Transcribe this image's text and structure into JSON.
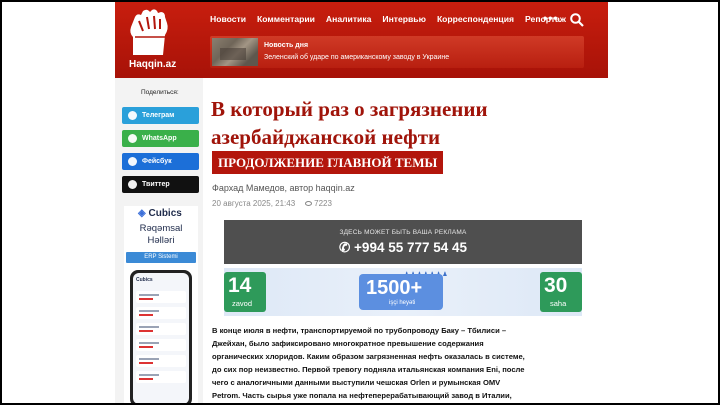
{
  "header": {
    "logo_text": "Haqqin.az",
    "nav": [
      "Новости",
      "Комментарии",
      "Аналитика",
      "Интервью",
      "Корреспонденция",
      "Репортаж"
    ],
    "more": "•••",
    "news_day": {
      "title": "Новость дня",
      "text": "Зеленский об ударе по американскому заводу в Украине"
    }
  },
  "sidebar": {
    "share_label": "Поделиться:",
    "share_buttons": [
      "Телеграм",
      "WhatsApp",
      "Фейсбук",
      "Твиттер"
    ],
    "ad": {
      "brand": "Cubics",
      "line1": "Rəqəmsal",
      "line2": "Həlləri",
      "button": "ERP Sistemi"
    }
  },
  "article": {
    "title": "В который раз о загрязнении азербайджанской нефти",
    "tag": "ПРОДОЛЖЕНИЕ ГЛАВНОЙ ТЕМЫ",
    "author": "Фархад Мамедов, автор haqqin.az",
    "date": "20 августа 2025, 21:43",
    "views": "7223",
    "body": "В конце июля в нефти, транспортируемой по трубопроводу Баку – Тбилиси – Джейхан, было зафиксировано многократное превышение содержания органических хлоридов. Каким образом загрязненная нефть оказалась в системе, до сих пор неизвестно. Первой тревогу подняла итальянская компания Eni, после чего с аналогичными данными выступили чешская Orlen и румынская OMV Petrom. Часть сырья уже попала на нефтеперерабатывающий завод в Италии, другие партии хранятся в резервуарах, а танкер Delta Blue,"
  },
  "ads": {
    "banner_line1": "ЗДЕСЬ МОЖЕТ БЫТЬ ВАША РЕКЛАМА",
    "banner_phone": "+994 55 777 54 45",
    "stats": [
      {
        "num": "14",
        "label": "zavod"
      },
      {
        "num": "1500+",
        "label": "işçi heyəti"
      },
      {
        "num": "30",
        "label": "saha"
      }
    ]
  }
}
